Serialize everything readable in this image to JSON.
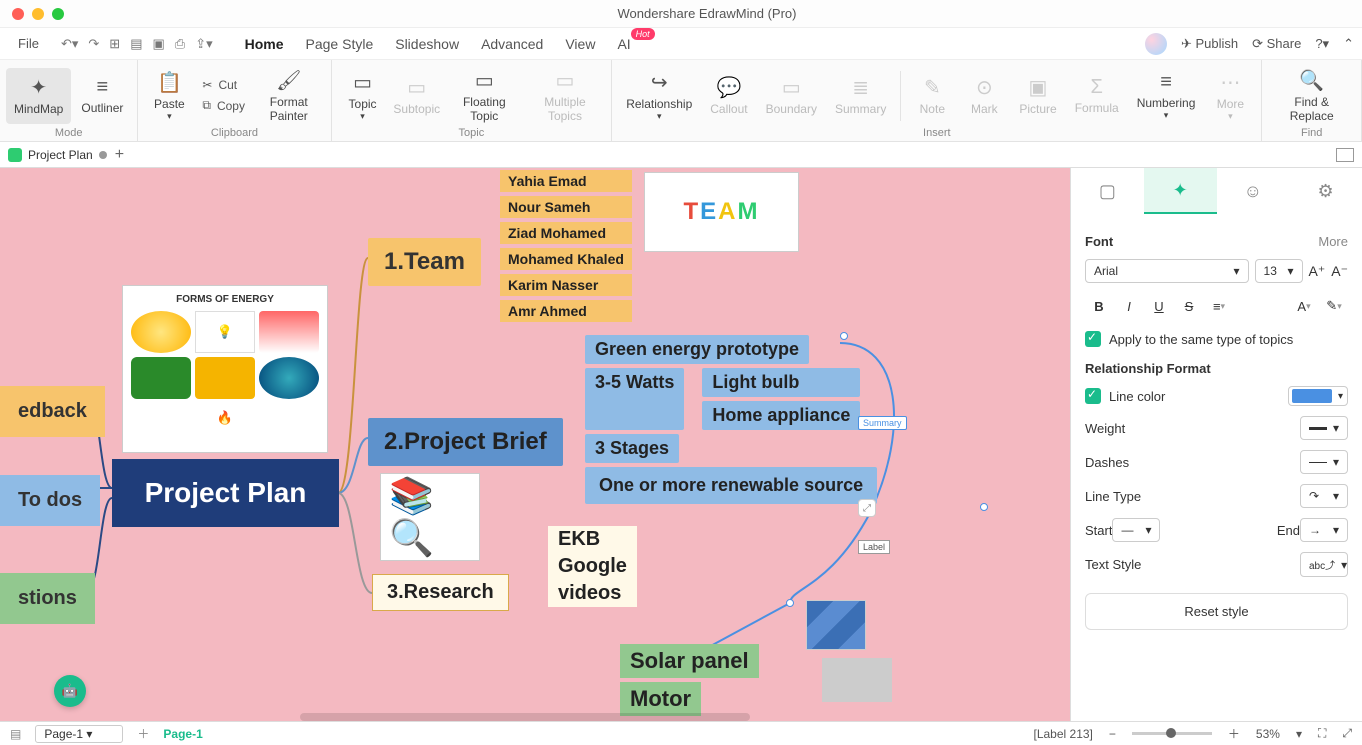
{
  "app": {
    "title": "Wondershare EdrawMind (Pro)"
  },
  "menubar": {
    "file": "File",
    "tabs": [
      "Home",
      "Page Style",
      "Slideshow",
      "Advanced",
      "View",
      "AI"
    ],
    "active_tab": "Home",
    "hot_badge": "Hot",
    "publish": "Publish",
    "share": "Share"
  },
  "ribbon": {
    "mode": {
      "mindmap": "MindMap",
      "outliner": "Outliner",
      "caption": "Mode"
    },
    "clipboard": {
      "paste": "Paste",
      "cut": "Cut",
      "copy": "Copy",
      "format_painter": "Format Painter",
      "caption": "Clipboard"
    },
    "topic": {
      "topic": "Topic",
      "subtopic": "Subtopic",
      "floating": "Floating Topic",
      "multiple": "Multiple Topics",
      "caption": "Topic"
    },
    "insert": {
      "relationship": "Relationship",
      "callout": "Callout",
      "boundary": "Boundary",
      "summary": "Summary",
      "note": "Note",
      "mark": "Mark",
      "picture": "Picture",
      "formula": "Formula",
      "numbering": "Numbering",
      "more": "More",
      "caption": "Insert"
    },
    "find": {
      "find_replace": "Find & Replace",
      "caption": "Find"
    }
  },
  "doc_tab": {
    "name": "Project Plan",
    "add": "+"
  },
  "mindmap": {
    "central": "Project Plan",
    "left": {
      "feedback": "edback",
      "todos": "To dos",
      "questions": "stions"
    },
    "team": {
      "title": "1.Team",
      "members": [
        "Yahia Emad",
        "Nour Sameh",
        "Ziad Mohamed",
        "Mohamed Khaled",
        "Karim Nasser",
        "Amr Ahmed"
      ]
    },
    "brief": {
      "title": "2.Project Brief",
      "items": [
        "Green energy prototype",
        "3-5 Watts",
        "Light bulb",
        "Home appliance",
        "3 Stages",
        "One or more renewable source"
      ]
    },
    "research": {
      "title": "3.Research",
      "items": [
        "EKB",
        "Google",
        "videos"
      ]
    },
    "solar": "Solar panel",
    "motor": "Motor",
    "summary_tag": "Summary",
    "label_tag": "Label",
    "energy_caption": "FORMS OF ENERGY"
  },
  "sidepanel": {
    "font_h": "Font",
    "more": "More",
    "font_family": "Arial",
    "font_size": "13",
    "apply_same": "Apply to the same type of topics",
    "rel_format": "Relationship Format",
    "line_color": "Line color",
    "weight": "Weight",
    "dashes": "Dashes",
    "line_type": "Line Type",
    "start": "Start",
    "end": "End",
    "text_style": "Text Style",
    "reset": "Reset style"
  },
  "status": {
    "page": "Page-1",
    "page_green": "Page-1",
    "label": "[Label 213]",
    "zoom": "53%"
  }
}
